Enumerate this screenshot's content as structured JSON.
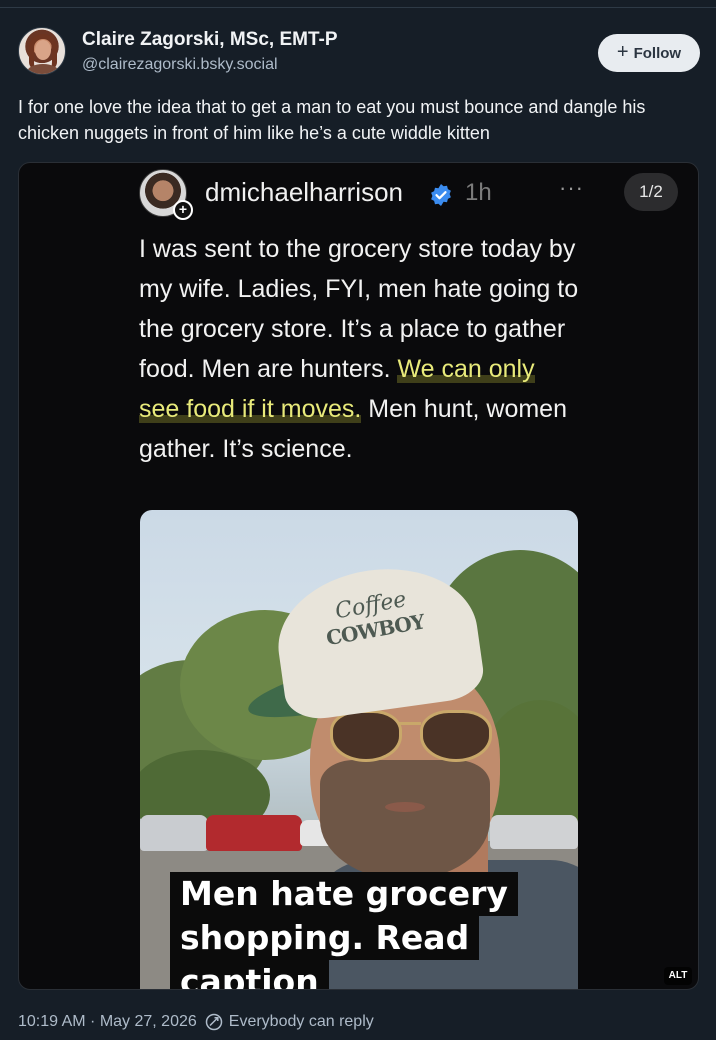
{
  "author": {
    "display_name": "Claire Zagorski, MSc, EMT-P",
    "handle": "@clairezagorski.bsky.social"
  },
  "follow_button": {
    "label": "Follow"
  },
  "post": {
    "text": "I for one love the idea that to get a man to eat you must bounce and dangle his chicken nuggets in front of him like he’s a cute widdle kitten"
  },
  "embedded": {
    "username": "dmichaelharrison",
    "time": "1h",
    "more": "···",
    "page_indicator": "1/2",
    "text_before": "I was sent to the grocery store today by my wife.  Ladies, FYI, men hate going to the grocery store. It’s a place to gather food. Men are hunters. ",
    "text_highlight": "We can only see food if it moves.",
    "text_after": "  Men hunt, women gather. It’s science.",
    "cap_script": "Coffee",
    "cap_brand": "COWBOY",
    "caption_lines": [
      "Men hate grocery",
      "shopping.  Read",
      "caption"
    ],
    "alt_badge": "ALT"
  },
  "footer": {
    "timestamp": "10:19 AM · May 27, 2026",
    "reply_setting": "Everybody can reply"
  },
  "colors": {
    "background": "#161e27",
    "highlight": "#e8ea7a",
    "verified": "#3b8cf0"
  }
}
